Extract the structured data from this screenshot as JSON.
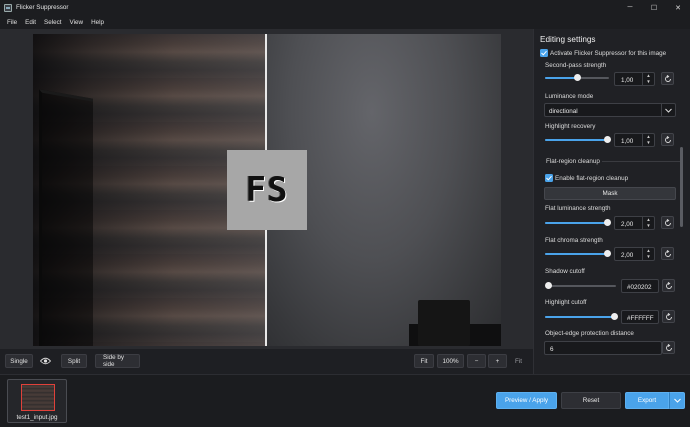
{
  "window": {
    "title": "Flicker Suppressor",
    "minimize": "─",
    "maximize": "☐",
    "close": "✕"
  },
  "menu": [
    "File",
    "Edit",
    "Select",
    "View",
    "Help"
  ],
  "viewer": {
    "logo_text": "FS"
  },
  "viewbar": {
    "single": "Single",
    "split": "Split",
    "side_by_side": "Side by side",
    "fit_button": "Fit",
    "zoom": "100%",
    "minus": "−",
    "plus": "+",
    "fit_label": "Fit"
  },
  "panel": {
    "title": "Editing settings",
    "activate": {
      "label": "Activate Flicker Suppressor for this image",
      "checked": true
    },
    "second_pass": {
      "label": "Second-pass strength",
      "value": "1,00",
      "fraction": 0.5
    },
    "luminance_mode": {
      "label": "Luminance mode",
      "value": "directional"
    },
    "highlight_recovery": {
      "label": "Highlight recovery",
      "value": "1,00",
      "fraction": 0.98
    },
    "flat_region": {
      "section": "Flat-region cleanup",
      "enable": {
        "label": "Enable flat-region cleanup",
        "checked": true
      },
      "mask": "Mask",
      "flat_lum": {
        "label": "Flat luminance strength",
        "value": "2,00",
        "fraction": 0.98
      },
      "flat_chroma": {
        "label": "Flat chroma strength",
        "value": "2,00",
        "fraction": 0.98
      },
      "shadow_cutoff": {
        "label": "Shadow cutoff",
        "value": "#020202",
        "fraction": 0.0
      },
      "highlight_cutoff": {
        "label": "Highlight cutoff",
        "value": "#FFFFFF",
        "fraction": 1.0
      },
      "edge_protection": {
        "label": "Object-edge protection distance",
        "value": "6"
      }
    }
  },
  "bottom": {
    "thumbnail_name": "test1_input.jpg",
    "preview_apply": "Preview / Apply",
    "reset": "Reset",
    "export": "Export"
  },
  "colors": {
    "accent": "#4aa3ea",
    "thumbnail_border": "#e0413a"
  }
}
